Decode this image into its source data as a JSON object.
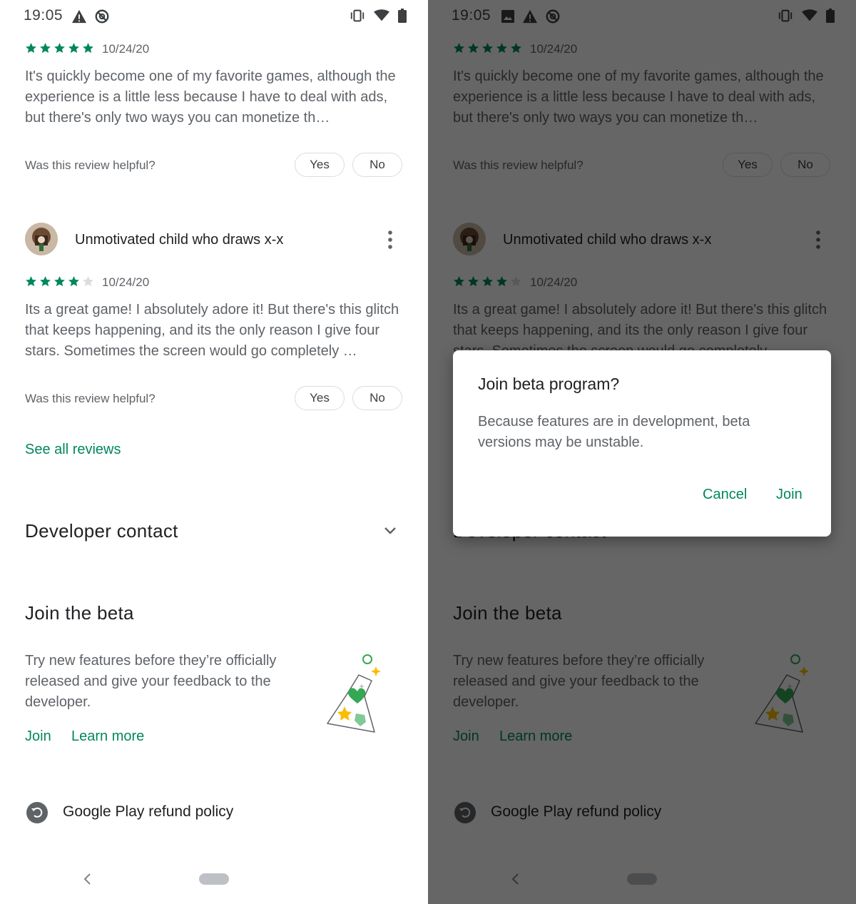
{
  "status_bar": {
    "time": "19:05"
  },
  "reviews": [
    {
      "rating": 5,
      "date": "10/24/20",
      "text": "It's quickly become one of my favorite games, although the experience is a little less because I have to deal with ads, but there's only two ways you can monetize th…",
      "helpful_prompt": "Was this review helpful?",
      "yes_label": "Yes",
      "no_label": "No"
    },
    {
      "author": "Unmotivated child who draws x-x",
      "rating": 4,
      "date": "10/24/20",
      "text": "Its a great game! I absolutely adore it! But there's this glitch that keeps happening, and its the only reason I give four stars. Sometimes the screen would go completely …",
      "helpful_prompt": "Was this review helpful?",
      "yes_label": "Yes",
      "no_label": "No"
    }
  ],
  "see_all_reviews": "See all reviews",
  "developer_contact": {
    "title": "Developer contact"
  },
  "beta": {
    "title": "Join the beta",
    "text": "Try new features before they’re officially released and give your feedback to the developer.",
    "join_label": "Join",
    "learn_more_label": "Learn more"
  },
  "refund": {
    "label": "Google Play refund policy"
  },
  "dialog": {
    "title": "Join beta program?",
    "body": "Because features are in development, beta versions may be unstable.",
    "cancel_label": "Cancel",
    "join_label": "Join"
  },
  "colors": {
    "accent": "#01875f",
    "star_filled": "#01875f",
    "star_empty": "#dadce0",
    "scrim": "rgba(0,0,0,0.6)"
  },
  "icons": [
    "warning-icon",
    "sync-disabled-icon",
    "image-icon",
    "vibrate-icon",
    "wifi-icon",
    "battery-icon",
    "more-vert-icon",
    "chevron-down-icon",
    "refund-icon",
    "back-icon",
    "beta-flask-illustration"
  ]
}
